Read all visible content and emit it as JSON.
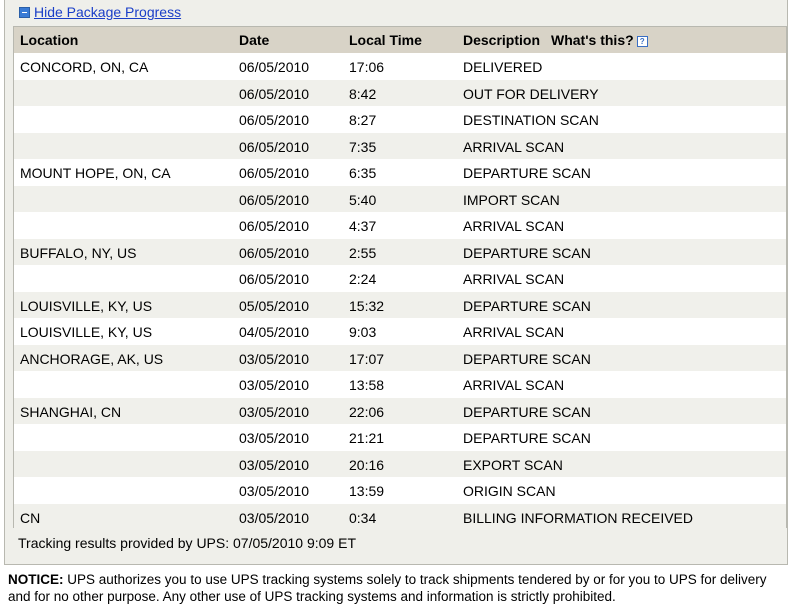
{
  "toggle_link": "Hide Package Progress",
  "columns": {
    "location": "Location",
    "date": "Date",
    "time": "Local Time",
    "description": "Description",
    "whats_this": "What's this?",
    "help_glyph": "?"
  },
  "rows": [
    {
      "location": "CONCORD, ON, CA",
      "date": "06/05/2010",
      "time": "17:06",
      "description": "DELIVERED"
    },
    {
      "location": "",
      "date": "06/05/2010",
      "time": "8:42",
      "description": "OUT FOR DELIVERY"
    },
    {
      "location": "",
      "date": "06/05/2010",
      "time": "8:27",
      "description": "DESTINATION SCAN"
    },
    {
      "location": "",
      "date": "06/05/2010",
      "time": "7:35",
      "description": "ARRIVAL SCAN"
    },
    {
      "location": "MOUNT HOPE, ON, CA",
      "date": "06/05/2010",
      "time": "6:35",
      "description": "DEPARTURE SCAN"
    },
    {
      "location": "",
      "date": "06/05/2010",
      "time": "5:40",
      "description": "IMPORT SCAN"
    },
    {
      "location": "",
      "date": "06/05/2010",
      "time": "4:37",
      "description": "ARRIVAL SCAN"
    },
    {
      "location": "BUFFALO, NY, US",
      "date": "06/05/2010",
      "time": "2:55",
      "description": "DEPARTURE SCAN"
    },
    {
      "location": "",
      "date": "06/05/2010",
      "time": "2:24",
      "description": "ARRIVAL SCAN"
    },
    {
      "location": "LOUISVILLE, KY, US",
      "date": "05/05/2010",
      "time": "15:32",
      "description": "DEPARTURE SCAN"
    },
    {
      "location": "LOUISVILLE, KY, US",
      "date": "04/05/2010",
      "time": "9:03",
      "description": "ARRIVAL SCAN"
    },
    {
      "location": "ANCHORAGE, AK, US",
      "date": "03/05/2010",
      "time": "17:07",
      "description": "DEPARTURE SCAN"
    },
    {
      "location": "",
      "date": "03/05/2010",
      "time": "13:58",
      "description": "ARRIVAL SCAN"
    },
    {
      "location": "SHANGHAI, CN",
      "date": "03/05/2010",
      "time": "22:06",
      "description": "DEPARTURE SCAN"
    },
    {
      "location": "",
      "date": "03/05/2010",
      "time": "21:21",
      "description": "DEPARTURE SCAN"
    },
    {
      "location": "",
      "date": "03/05/2010",
      "time": "20:16",
      "description": "EXPORT SCAN"
    },
    {
      "location": "",
      "date": "03/05/2010",
      "time": "13:59",
      "description": "ORIGIN SCAN"
    },
    {
      "location": "CN",
      "date": "03/05/2010",
      "time": "0:34",
      "description": "BILLING INFORMATION RECEIVED"
    }
  ],
  "footer": "Tracking results provided by UPS:  07/05/2010 9:09  ET",
  "notice": {
    "label": "NOTICE:",
    "text": " UPS authorizes you to use UPS tracking systems solely to track shipments tendered by or for you to UPS for delivery and for no other purpose. Any other use of UPS tracking systems and information is strictly prohibited."
  },
  "colors": {
    "panel_bg": "#efefea",
    "header_bg": "#d8d3c7",
    "alt_row_bg": "#f0f0eb",
    "link": "#1a3ec8"
  },
  "icons": {
    "toggle": "minus-box-icon",
    "help": "question-mark-icon"
  }
}
